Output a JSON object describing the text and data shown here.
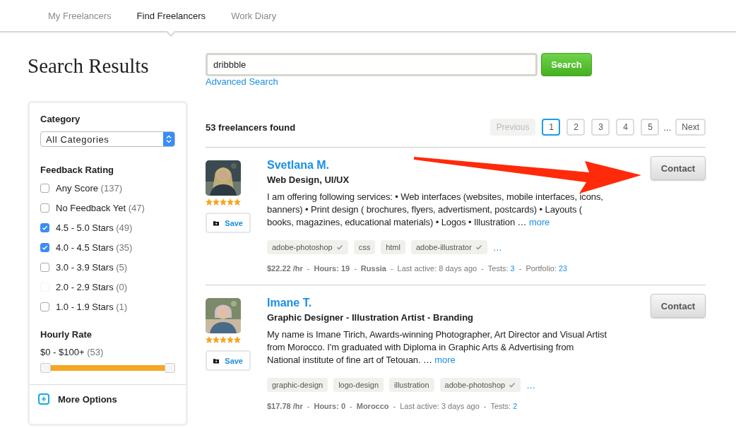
{
  "nav": {
    "tabs": [
      {
        "label": "My Freelancers",
        "selected": false
      },
      {
        "label": "Find Freelancers",
        "selected": true
      },
      {
        "label": "Work Diary",
        "selected": false
      }
    ]
  },
  "title": "Search Results",
  "search": {
    "value": "dribbble",
    "button": "Search",
    "advanced": "Advanced Search"
  },
  "filters": {
    "category": {
      "label": "Category",
      "value": "All Categories"
    },
    "feedback": {
      "label": "Feedback Rating",
      "options": [
        {
          "label": "Any Score",
          "count": "(137)",
          "checked": false,
          "disabled": false
        },
        {
          "label": "No Feedback Yet",
          "count": "(47)",
          "checked": false,
          "disabled": false
        },
        {
          "label": "4.5 - 5.0 Stars",
          "count": "(49)",
          "checked": true,
          "disabled": false
        },
        {
          "label": "4.0 - 4.5 Stars",
          "count": "(35)",
          "checked": true,
          "disabled": false
        },
        {
          "label": "3.0 - 3.9 Stars",
          "count": "(5)",
          "checked": false,
          "disabled": false
        },
        {
          "label": "2.0 - 2.9 Stars",
          "count": "(0)",
          "checked": false,
          "disabled": true
        },
        {
          "label": "1.0 - 1.9 Stars",
          "count": "(1)",
          "checked": false,
          "disabled": false
        }
      ]
    },
    "rate": {
      "label": "Hourly Rate",
      "range": "$0 - $100+",
      "count": "(53)",
      "thumbs": [
        {
          "level": 0
        },
        {
          "level": 1
        }
      ]
    },
    "more_options": "More Options"
  },
  "results": {
    "count": "53 freelancers found",
    "pagination": {
      "previous": "Previous",
      "pages": [
        {
          "label": "1",
          "selected": true
        },
        {
          "label": "2",
          "selected": false
        },
        {
          "label": "3",
          "selected": false
        },
        {
          "label": "4",
          "selected": false
        },
        {
          "label": "5",
          "selected": false
        }
      ],
      "ellipsis": "...",
      "next": "Next"
    },
    "freelancers": [
      {
        "name": "Svetlana M.",
        "title": "Web Design, UI/UX",
        "stars": 5,
        "save": "Save",
        "contact": "Contact",
        "description": "I am offering following services: • Web interfaces (websites, mobile interfaces, icons, banners) • Print design ( brochures, flyers, advertisment, postcards) • Layouts ( books, magazines, educational materials) • Logos • Illustration …",
        "more": "more",
        "skills": [
          {
            "label": "adobe-photoshop",
            "verified": true
          },
          {
            "label": "css",
            "verified": false
          },
          {
            "label": "html",
            "verified": false
          },
          {
            "label": "adobe-illustrator",
            "verified": true
          }
        ],
        "skills_more": "…",
        "separator": "-",
        "rate": "$22.22 /hr",
        "hours": "Hours: 19",
        "country": "Russia",
        "last_active": "Last active:  8 days ago",
        "stats": [
          {
            "label": "Tests:",
            "value": "3"
          },
          {
            "label": "Portfolio:",
            "value": "23"
          }
        ]
      },
      {
        "name": "Imane T.",
        "title": "Graphic Designer - Illustration Artist - Branding",
        "stars": 5,
        "save": "Save",
        "contact": "Contact",
        "description": "My name is Imane Tirich, Awards-winning Photographer, Art Director and Visual Artist from Morocco. I'm graduated with Diploma in Graphic Arts & Advertising from National institute of fine art of Tetouan. …",
        "more": "more",
        "skills": [
          {
            "label": "graphic-design",
            "verified": false
          },
          {
            "label": "logo-design",
            "verified": false
          },
          {
            "label": "illustration",
            "verified": false
          },
          {
            "label": "adobe-photoshop",
            "verified": true
          }
        ],
        "skills_more": "…",
        "separator": "-",
        "rate": "$17.78 /hr",
        "hours": "Hours: 0",
        "country": "Morocco",
        "last_active": "Last active:  3 days ago",
        "stats": [
          {
            "label": "Tests:",
            "value": "2"
          }
        ]
      }
    ]
  }
}
